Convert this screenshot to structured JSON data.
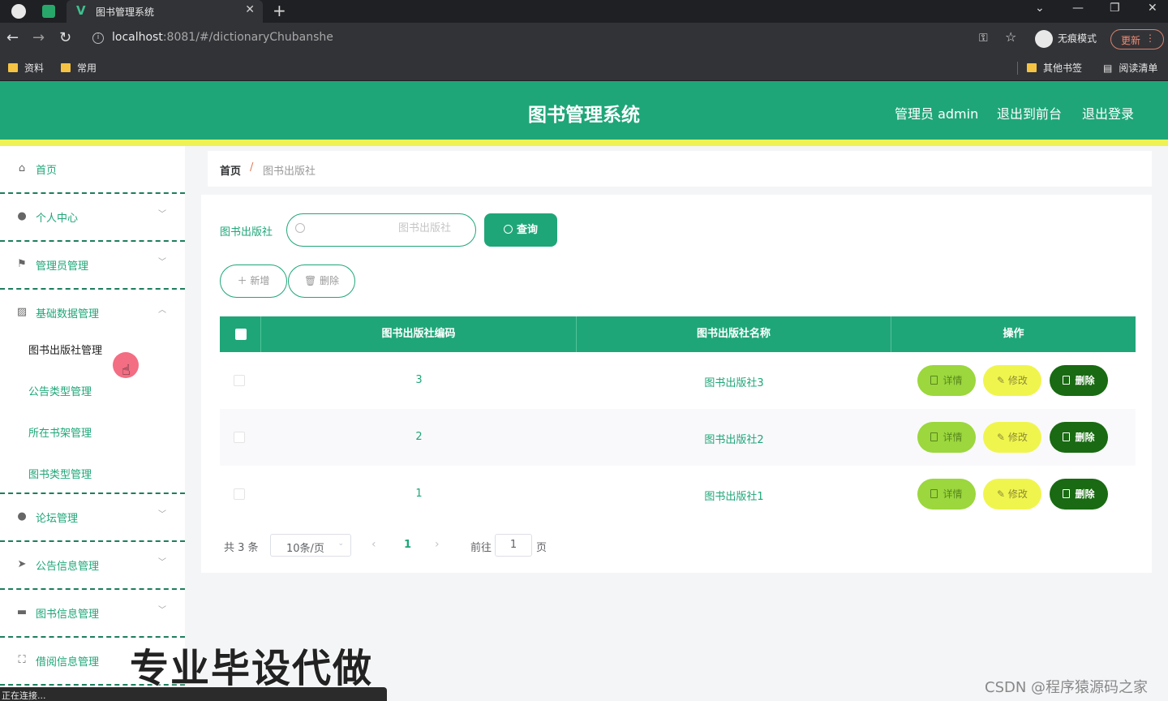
{
  "browser": {
    "tab_title": "图书管理系统",
    "url_host": "localhost",
    "url_rest": ":8081/#/dictionaryChubanshe",
    "incognito_label": "无痕模式",
    "update_label": "更新",
    "bookmarks": [
      "资料",
      "常用"
    ],
    "bookmarks_right": [
      "其他书签",
      "阅读清单"
    ],
    "status_text": "正在连接..."
  },
  "header": {
    "title": "图书管理系统",
    "user_label": "管理员 admin",
    "back_to_front": "退出到前台",
    "logout": "退出登录"
  },
  "sidebar": {
    "home": "首页",
    "items": [
      {
        "label": "个人中心",
        "icon": "user-icon"
      },
      {
        "label": "管理员管理",
        "icon": "flag-icon"
      },
      {
        "label": "基础数据管理",
        "icon": "chart-icon"
      },
      {
        "label": "论坛管理",
        "icon": "user-icon"
      },
      {
        "label": "公告信息管理",
        "icon": "send-icon"
      },
      {
        "label": "图书信息管理",
        "icon": "briefcase-icon"
      },
      {
        "label": "借阅信息管理",
        "icon": "fullscreen-icon"
      }
    ],
    "sub_items": [
      "图书出版社管理",
      "公告类型管理",
      "所在书架管理",
      "图书类型管理"
    ]
  },
  "breadcrumb": {
    "home": "首页",
    "separator": "/",
    "current": "图书出版社"
  },
  "search": {
    "label": "图书出版社",
    "placeholder": "图书出版社",
    "query_button": "查询"
  },
  "toolbar": {
    "add": "新增",
    "delete": "删除"
  },
  "table": {
    "columns": [
      "图书出版社编码",
      "图书出版社名称",
      "操作"
    ],
    "rows": [
      {
        "code": "3",
        "name": "图书出版社3"
      },
      {
        "code": "2",
        "name": "图书出版社2"
      },
      {
        "code": "1",
        "name": "图书出版社1"
      }
    ],
    "actions": {
      "detail": "详情",
      "edit": "修改",
      "delete": "删除"
    }
  },
  "pagination": {
    "total": "共 3 条",
    "page_size": "10条/页",
    "current_page": "1",
    "goto_label": "前往",
    "goto_value": "1",
    "page_unit": "页"
  },
  "overlays": {
    "promo_text": "专业毕设代做",
    "csdn_watermark": "CSDN @程序猿源码之家"
  },
  "colors": {
    "primary": "#1fa678",
    "accent_yellow": "#eef254",
    "detail_btn": "#9bd73d",
    "edit_btn": "#f0f54e",
    "delete_btn": "#196a12"
  }
}
